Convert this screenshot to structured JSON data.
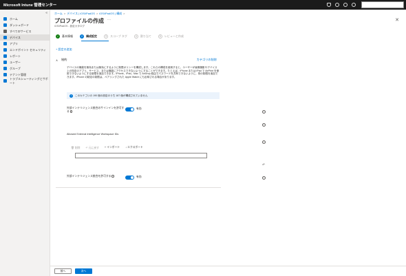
{
  "topbar": {
    "title": "Microsoft Intune 管理センター"
  },
  "sidebar": {
    "items": [
      {
        "label": "ホーム",
        "icon": "home-icon",
        "color": "#0078d4"
      },
      {
        "label": "ダッシュボード",
        "icon": "dashboard-icon",
        "color": "#0078d4"
      },
      {
        "label": "すべてのサービス",
        "icon": "all-services-icon",
        "color": "#605e5c"
      },
      {
        "label": "デバイス",
        "icon": "devices-icon",
        "color": "#0078d4"
      },
      {
        "label": "アプリ",
        "icon": "apps-icon",
        "color": "#0078d4"
      },
      {
        "label": "エンドポイント セキュリティ",
        "icon": "endpoint-security-icon",
        "color": "#0078d4"
      },
      {
        "label": "レポート",
        "icon": "reports-icon",
        "color": "#0078d4"
      },
      {
        "label": "ユーザー",
        "icon": "users-icon",
        "color": "#0078d4"
      },
      {
        "label": "グループ",
        "icon": "groups-icon",
        "color": "#0078d4"
      },
      {
        "label": "テナント管理",
        "icon": "tenant-admin-icon",
        "color": "#0078d4"
      },
      {
        "label": "トラブルシューティングとサポート",
        "icon": "troubleshooting-icon",
        "color": "#0078d4"
      }
    ]
  },
  "breadcrumb": {
    "items": [
      "ホーム",
      "デバイス | iOS/iPadOS",
      "iOS/iPadOS | 構成"
    ]
  },
  "page": {
    "title": "プロファイルの作成",
    "subtitle": "iOS/iPadOS - 設定カタログ"
  },
  "steps": [
    {
      "label": "基本情報",
      "state": "done"
    },
    {
      "label": "構成設定",
      "state": "current",
      "num": "2"
    },
    {
      "label": "スコープ タグ",
      "state": "pending",
      "num": "3"
    },
    {
      "label": "割り当て",
      "state": "pending",
      "num": "4"
    },
    {
      "label": "レビューと作成",
      "state": "pending",
      "num": "5"
    }
  ],
  "add_settings": "+ 設定の追加",
  "section": {
    "title": "制約",
    "remove": "カテゴリの削除",
    "description": "デバイスの機能を無効または無効にするように制限ポリシーを構成します。これらの構成を使用すると、ユーザーが画像撮影やデバイス上の特定のアプリ、サービス、または機能にアクセスできないようにすることができます。たとえば、iPhone または iPad で AirPrint を使用できないようにする制限を追加できます。iPhone、iPad、Mac で AirDrop 経由でパスワードを共有できないように、別の制限を追加できます。iPhone の制定の制限は、ペアリングされた Apple Watch にも反映される場合があります。",
    "info": "このカテゴリの 190 個の設定のうち 187 個が構成されていません"
  },
  "settings": {
    "external_signin": {
      "label": "外部インテリジェンス統合のサインインを許可する",
      "value": "有効"
    },
    "workspace_ids": {
      "label": "Allowed External Intelligence Workspace IDs",
      "toolbar": {
        "delete": "削除",
        "undo": "元に戻す",
        "import": "インポート",
        "export": "エクスポート"
      },
      "input_value": ""
    },
    "external_integration": {
      "label": "外部インテリジェンス統合を許可する",
      "value": "有効"
    }
  },
  "footer": {
    "back": "前へ",
    "next": "次へ"
  },
  "colors": {
    "accent": "#0078d4",
    "success": "#107c10"
  }
}
